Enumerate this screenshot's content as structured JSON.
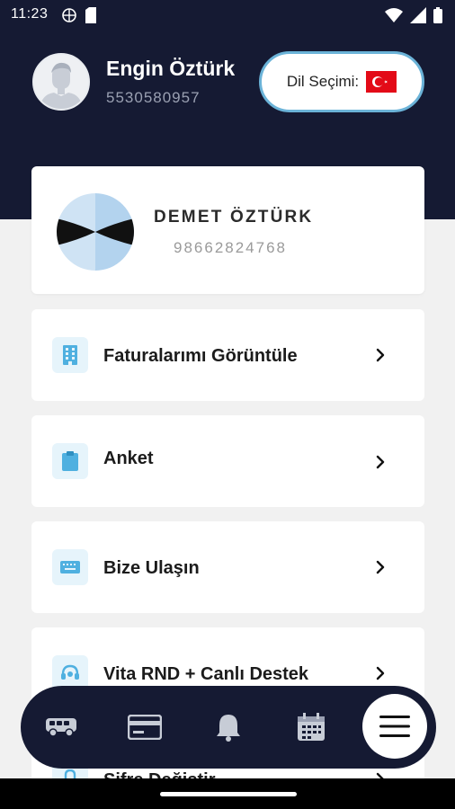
{
  "status_bar": {
    "time": "11:23"
  },
  "user": {
    "name": "Engin Öztürk",
    "phone": "5530580957"
  },
  "language": {
    "label": "Dil Seçimi:",
    "flag": "turkey-flag"
  },
  "company": {
    "name": "DEMET ÖZTÜRK",
    "id": "98662824768"
  },
  "menu": [
    {
      "label": "Faturalarımı Görüntüle",
      "icon": "building-icon"
    },
    {
      "label": "Anket",
      "icon": "clipboard-icon"
    },
    {
      "label": "Bize Ulaşın",
      "icon": "keyboard-icon"
    },
    {
      "label": "Vita RND + Canlı Destek",
      "icon": "headset-icon"
    },
    {
      "label": "Şifre Değiştir",
      "icon": "lock-icon"
    }
  ],
  "bottom_nav": [
    "bus-icon",
    "card-icon",
    "bell-icon",
    "calendar-icon",
    "menu-icon"
  ],
  "colors": {
    "header_bg": "#151a33",
    "accent": "#6bb3d8",
    "icon_bg": "#e6f4fb",
    "icon_color": "#4fb0e0"
  }
}
